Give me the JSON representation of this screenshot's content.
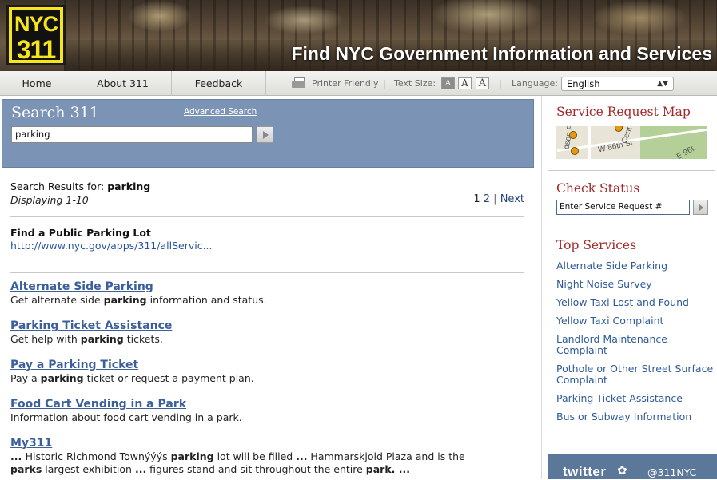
{
  "header": {
    "logo_line1": "NYC",
    "logo_line2": "311",
    "tagline": "Find NYC Government Information and Services"
  },
  "nav": {
    "items": [
      {
        "label": "Home"
      },
      {
        "label": "About 311"
      },
      {
        "label": "Feedback"
      }
    ],
    "printer_friendly": "Printer Friendly",
    "text_size_label": "Text Size:",
    "text_size_options": [
      "A",
      "A",
      "A"
    ],
    "language_label": "Language:",
    "language_selected": "English"
  },
  "search": {
    "title": "Search 311",
    "advanced_link": "Advanced Search",
    "query": "parking"
  },
  "results": {
    "prefix": "Search Results for:",
    "term": "parking",
    "displaying": "Displaying 1-10",
    "pager": {
      "current": "1",
      "page2": "2",
      "separator": "|",
      "next": "Next"
    },
    "featured": {
      "title": "Find a Public Parking Lot",
      "url": "http://www.nyc.gov/apps/311/allServic..."
    },
    "items": [
      {
        "title": "Alternate Side Parking",
        "desc_before": "Get alternate side ",
        "desc_bold": "parking",
        "desc_after": " information and status."
      },
      {
        "title": "Parking Ticket Assistance",
        "desc_before": "Get help with ",
        "desc_bold": "parking",
        "desc_after": " tickets."
      },
      {
        "title": "Pay a Parking Ticket",
        "desc_before": "Pay a ",
        "desc_bold": "parking",
        "desc_after": " ticket or request a payment plan."
      },
      {
        "title": "Food Cart Vending in a Park",
        "desc_before": "Information about food cart vending in a park.",
        "desc_bold": "",
        "desc_after": ""
      },
      {
        "title": "My311",
        "line1_a": "... ",
        "line1_b": "Historic Richmond Townýýýs ",
        "line1_bold": "parking",
        "line1_c": " lot will be filled ",
        "line1_d": "...",
        "line1_e": " Hammarskjold Plaza and is the",
        "line2_bold1": "parks",
        "line2_a": " largest exhibition ",
        "line2_b": "...",
        "line2_c": " figures stand and sit throughout the entire ",
        "line2_bold2": "park",
        "line2_d": ". ..."
      }
    ]
  },
  "sidebar": {
    "service_request_map": {
      "title": "Service Request Map",
      "map_labels": [
        "W 86th St",
        "dson P",
        "Cent",
        "E 96t"
      ]
    },
    "check_status": {
      "title": "Check Status",
      "placeholder": "Enter Service Request #"
    },
    "top_services": {
      "title": "Top Services",
      "items": [
        "Alternate Side Parking",
        "Night Noise Survey",
        "Yellow Taxi Lost and Found",
        "Yellow Taxi Complaint",
        "Landlord Maintenance Complaint",
        "Pothole or Other Street Surface Complaint",
        "Parking Ticket Assistance",
        "Bus or Subway Information"
      ]
    },
    "twitter": {
      "logo": "twitter",
      "handle": "@311NYC"
    }
  },
  "colors": {
    "search_panel_bg": "#7b93b4",
    "sidebar_heading": "#a22929",
    "link": "#2e5a9a",
    "logo_yellow": "#f7e51b"
  }
}
